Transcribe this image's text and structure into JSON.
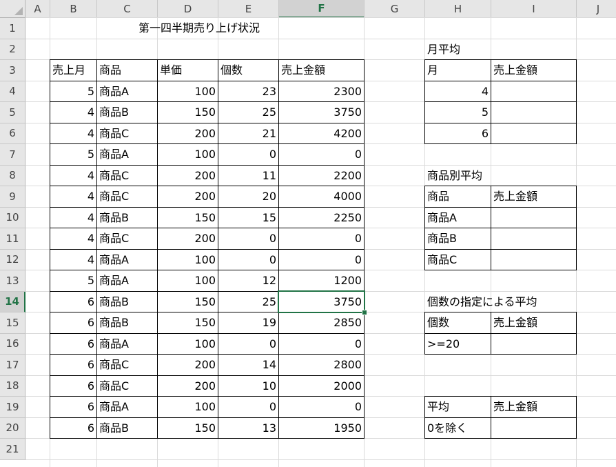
{
  "sheet": {
    "columns": [
      "A",
      "B",
      "C",
      "D",
      "E",
      "F",
      "G",
      "H",
      "I",
      "J"
    ],
    "rows": [
      "1",
      "2",
      "3",
      "4",
      "5",
      "6",
      "7",
      "8",
      "9",
      "10",
      "11",
      "12",
      "13",
      "14",
      "15",
      "16",
      "17",
      "18",
      "19",
      "20",
      "21"
    ],
    "selected_col": "F",
    "selected_row": "14",
    "title": "第一四半期売り上げ状況"
  },
  "main_table": {
    "headers": [
      "売上月",
      "商品",
      "単価",
      "個数",
      "売上金額"
    ],
    "rows": [
      [
        "5",
        "商品A",
        "100",
        "23",
        "2300"
      ],
      [
        "4",
        "商品B",
        "150",
        "25",
        "3750"
      ],
      [
        "4",
        "商品C",
        "200",
        "21",
        "4200"
      ],
      [
        "5",
        "商品A",
        "100",
        "0",
        "0"
      ],
      [
        "4",
        "商品C",
        "200",
        "11",
        "2200"
      ],
      [
        "4",
        "商品C",
        "200",
        "20",
        "4000"
      ],
      [
        "4",
        "商品B",
        "150",
        "15",
        "2250"
      ],
      [
        "4",
        "商品C",
        "200",
        "0",
        "0"
      ],
      [
        "4",
        "商品A",
        "100",
        "0",
        "0"
      ],
      [
        "5",
        "商品A",
        "100",
        "12",
        "1200"
      ],
      [
        "6",
        "商品B",
        "150",
        "25",
        "3750"
      ],
      [
        "6",
        "商品B",
        "150",
        "19",
        "2850"
      ],
      [
        "6",
        "商品A",
        "100",
        "0",
        "0"
      ],
      [
        "6",
        "商品C",
        "200",
        "14",
        "2800"
      ],
      [
        "6",
        "商品C",
        "200",
        "10",
        "2000"
      ],
      [
        "6",
        "商品A",
        "100",
        "0",
        "0"
      ],
      [
        "6",
        "商品B",
        "150",
        "13",
        "1950"
      ]
    ]
  },
  "monthly": {
    "label": "月平均",
    "headers": [
      "月",
      "売上金額"
    ],
    "rows": [
      [
        "4",
        ""
      ],
      [
        "5",
        ""
      ],
      [
        "6",
        ""
      ]
    ]
  },
  "by_product": {
    "label": "商品別平均",
    "headers": [
      "商品",
      "売上金額"
    ],
    "rows": [
      [
        "商品A",
        ""
      ],
      [
        "商品B",
        ""
      ],
      [
        "商品C",
        ""
      ]
    ]
  },
  "by_count": {
    "label": "個数の指定による平均",
    "headers": [
      "個数",
      "売上金額"
    ],
    "rows": [
      [
        ">=20",
        ""
      ]
    ]
  },
  "excl_zero": {
    "headers": [
      "平均",
      "売上金額"
    ],
    "rows": [
      [
        "0を除く",
        ""
      ]
    ]
  }
}
